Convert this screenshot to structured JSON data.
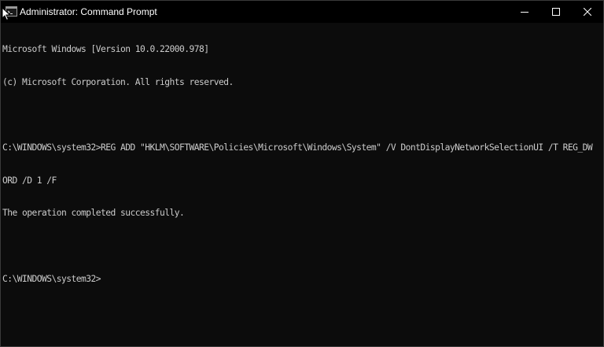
{
  "window": {
    "title": "Administrator: Command Prompt",
    "icon": "cmd-icon"
  },
  "controls": {
    "minimize_icon": "minimize-icon",
    "maximize_icon": "maximize-icon",
    "close_icon": "close-icon"
  },
  "console": {
    "lines": [
      "Microsoft Windows [Version 10.0.22000.978]",
      "(c) Microsoft Corporation. All rights reserved.",
      "",
      "C:\\WINDOWS\\system32>REG ADD \"HKLM\\SOFTWARE\\Policies\\Microsoft\\Windows\\System\" /V DontDisplayNetworkSelectionUI /T REG_DW",
      "ORD /D 1 /F",
      "The operation completed successfully.",
      "",
      "C:\\WINDOWS\\system32>"
    ]
  },
  "colors": {
    "background": "#0c0c0c",
    "titlebar": "#000000",
    "text": "#cccccc",
    "title_text": "#ffffff"
  }
}
